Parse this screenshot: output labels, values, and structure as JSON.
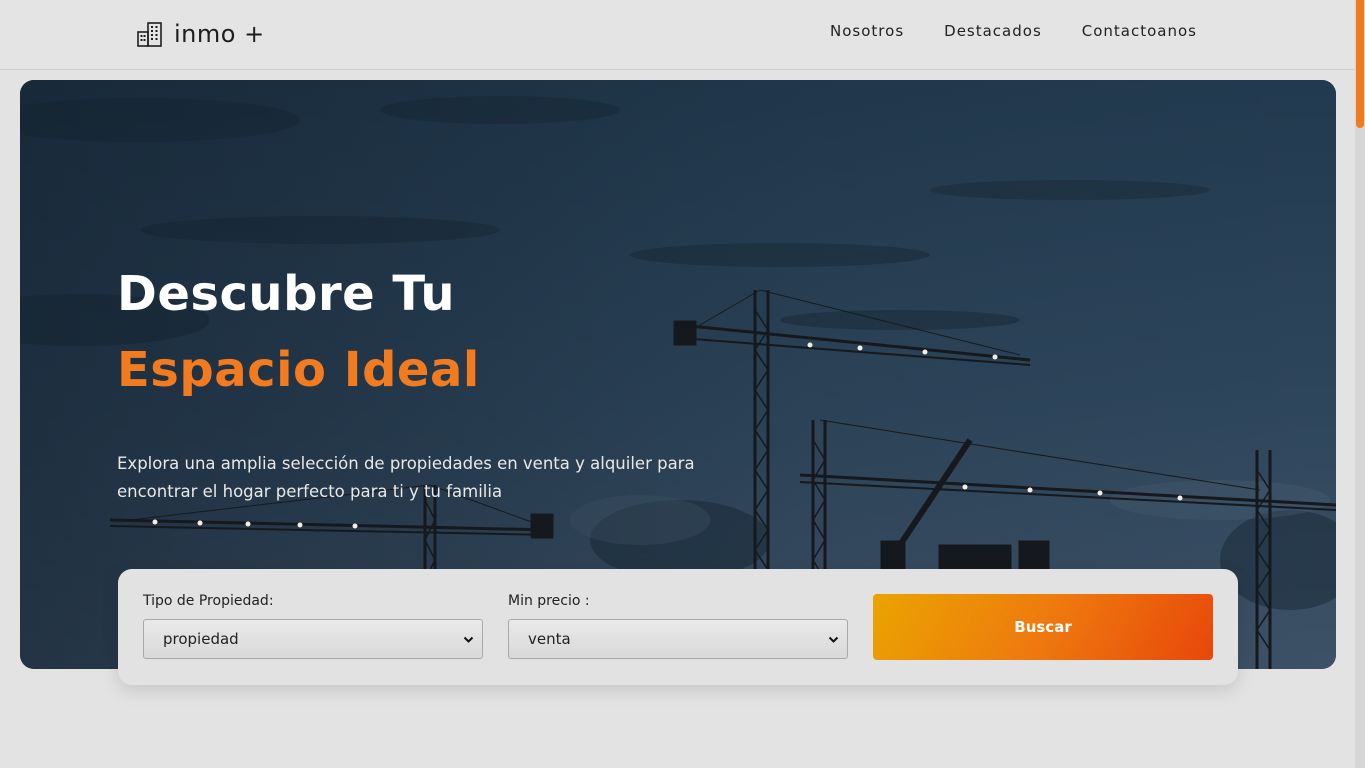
{
  "header": {
    "brand": "inmo +",
    "nav": [
      "Nosotros",
      "Destacados",
      "Contactoanos"
    ]
  },
  "hero": {
    "title_line1": "Descubre Tu",
    "title_line2": "Espacio Ideal",
    "subtitle": "Explora una amplia selección de propiedades en venta y alquiler para encontrar el hogar perfecto para ti y tu familia"
  },
  "search": {
    "tipo_label": "Tipo de Propiedad:",
    "tipo_value": "propiedad",
    "precio_label": "Min precio :",
    "precio_value": "venta",
    "button": "Buscar"
  },
  "colors": {
    "accent": "#f27b1f",
    "button_gradient": [
      "#eaa400",
      "#e8470a"
    ],
    "hero_sky": "#2b4257"
  },
  "icons": [
    "building-icon",
    "chevron-down-icon"
  ]
}
